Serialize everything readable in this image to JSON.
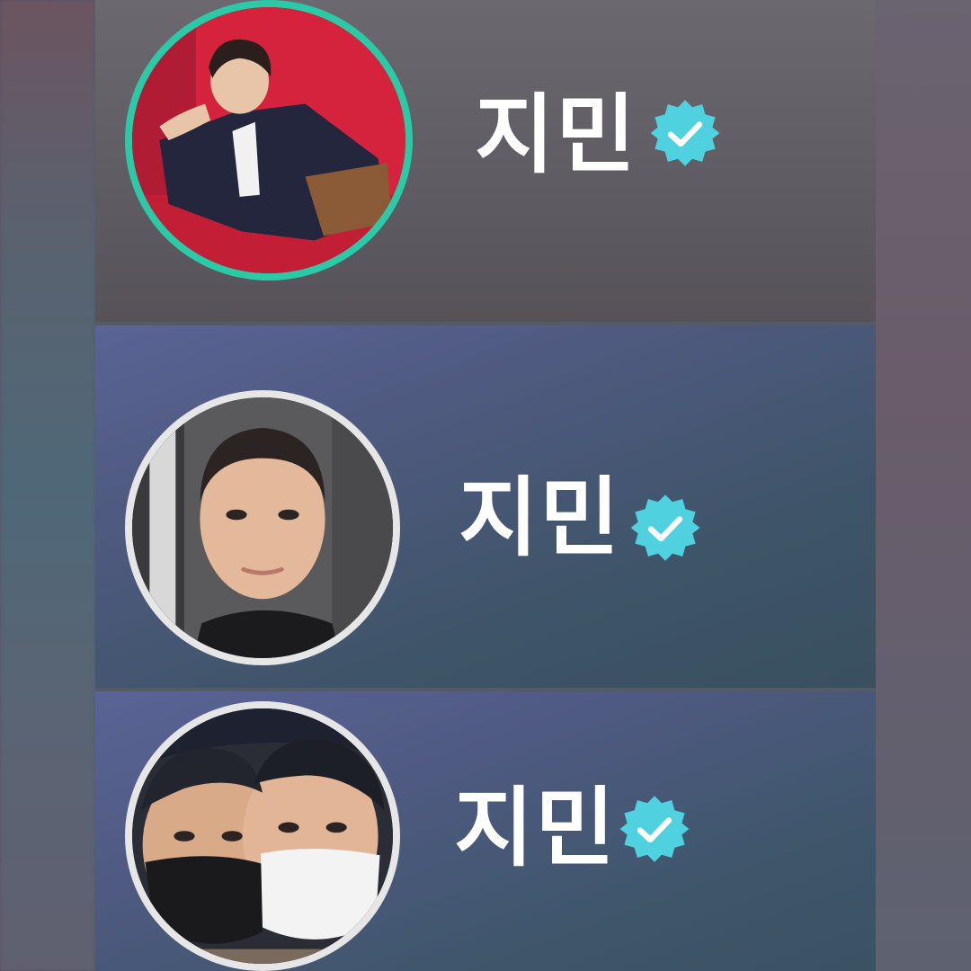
{
  "profiles": [
    {
      "name": "지민",
      "verified": true,
      "ring_color": "#2bc9a6",
      "avatar": "photo-person-reclining-red-background"
    },
    {
      "name": "지민",
      "verified": true,
      "ring_color": "#e6e6e6",
      "avatar": "photo-person-selfie-short-hair"
    },
    {
      "name": "지민",
      "verified": true,
      "ring_color": "#e6e6e6",
      "avatar": "photo-two-people-face-masks"
    }
  ],
  "badge": {
    "icon": "verified-check-icon",
    "color": "#4fd1e0"
  }
}
